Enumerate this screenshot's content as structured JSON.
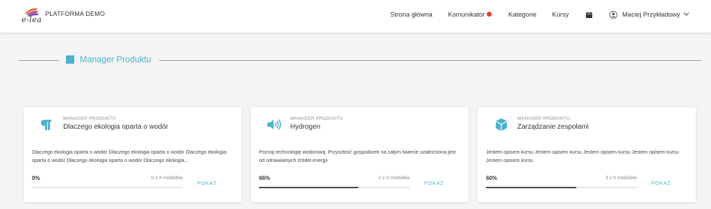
{
  "header": {
    "logo_text": "e-lea",
    "platform_title": "PLATFORMA DEMO",
    "nav": {
      "home": "Strona główna",
      "messenger": "Komunikator",
      "categories": "Kategorie",
      "courses": "Kursy"
    },
    "notification_color": "#e53935",
    "calendar_icon": "calendar-icon",
    "user": {
      "name": "Maciej Przykładowy",
      "avatar_icon": "user-avatar-icon",
      "menu_icon": "chevron-down-icon"
    }
  },
  "section": {
    "title": "Manager Produktu",
    "accent": "#4cb3cf"
  },
  "cards": [
    {
      "icon": "paragraph-icon",
      "category": "MANAGER PRODUKTU",
      "title": "Dlaczego ekologia oparta o wodór",
      "description": "Dlaczego ekologia oparta o wodór Dlaczego ekologia oparta o wodór Dlaczego ekologia oparta o wodór Dlaczego ekologia oparta o wodór Dlaczego ekologia...",
      "progress_label": "0%",
      "progress": 0.0,
      "modules": "0 z 4 modułów",
      "button": "POKAŻ"
    },
    {
      "icon": "volume-icon",
      "category": "MANAGER PRODUKTU",
      "title": "Hydrogen",
      "description": "Poznaj technologię wodorową. Przyszłość gospodarek na całym świecie uzależniona jest od odnawialnych źródeł energii",
      "progress_label": "66%",
      "progress": 0.66,
      "modules": "2 z 3 modułów",
      "button": "POKAŻ"
    },
    {
      "icon": "cube-icon",
      "category": "MANAGER PRODUKTU",
      "title": "Zarządzanie zespołami",
      "description": "Jestem opisem kursu Jestem opisem kursu Jestem opisem kursu Jestem opisem kursu Jestem opisem kursu",
      "progress_label": "60%",
      "progress": 0.6,
      "modules": "3 z 5 modułów",
      "button": "POKAŻ"
    }
  ]
}
